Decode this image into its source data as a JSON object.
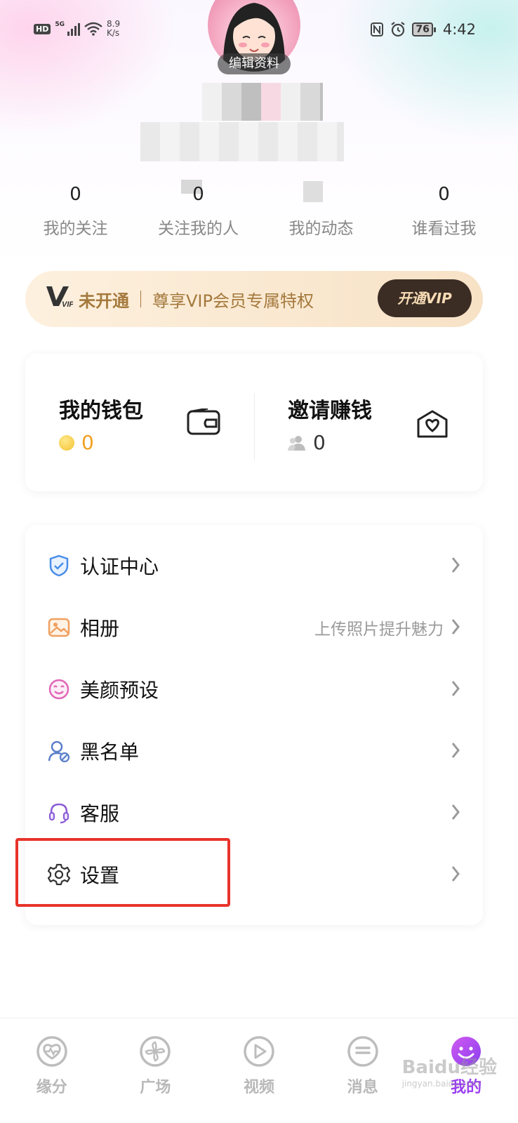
{
  "status_bar": {
    "hd": "HD",
    "network": "5G",
    "speed_value": "8.9",
    "speed_unit": "K/s",
    "battery": "76",
    "time": "4:42"
  },
  "profile": {
    "edit_label": "编辑资料"
  },
  "stats": [
    {
      "value": "0",
      "label": "我的关注"
    },
    {
      "value": "0",
      "label": "关注我的人"
    },
    {
      "value": "",
      "label": "我的动态"
    },
    {
      "value": "0",
      "label": "谁看过我"
    }
  ],
  "vip": {
    "logo": "VIP",
    "status": "未开通",
    "desc": "尊享VIP会员专属特权",
    "button": "开通VIP"
  },
  "wallet": {
    "title": "我的钱包",
    "value": "0"
  },
  "invite": {
    "title": "邀请赚钱",
    "value": "0"
  },
  "menu": [
    {
      "label": "认证中心",
      "hint": "",
      "icon": "shield-icon"
    },
    {
      "label": "相册",
      "hint": "上传照片提升魅力",
      "icon": "photo-icon"
    },
    {
      "label": "美颜预设",
      "hint": "",
      "icon": "smile-icon"
    },
    {
      "label": "黑名单",
      "hint": "",
      "icon": "user-block-icon"
    },
    {
      "label": "客服",
      "hint": "",
      "icon": "headset-icon"
    },
    {
      "label": "设置",
      "hint": "",
      "icon": "gear-icon"
    }
  ],
  "bottom_nav": [
    {
      "label": "缘分",
      "icon": "heart-pulse-icon",
      "active": false
    },
    {
      "label": "广场",
      "icon": "pinwheel-icon",
      "active": false
    },
    {
      "label": "视频",
      "icon": "play-icon",
      "active": false
    },
    {
      "label": "消息",
      "icon": "message-icon",
      "active": false
    },
    {
      "label": "我的",
      "icon": "smiley-avatar-icon",
      "active": true
    }
  ],
  "watermark": {
    "brand": "Baidu经验",
    "url": "jingyan.baidu.com"
  },
  "colors": {
    "accent": "#9a3ef0",
    "vip_gold": "#a4793d",
    "highlight": "#e8332b"
  }
}
